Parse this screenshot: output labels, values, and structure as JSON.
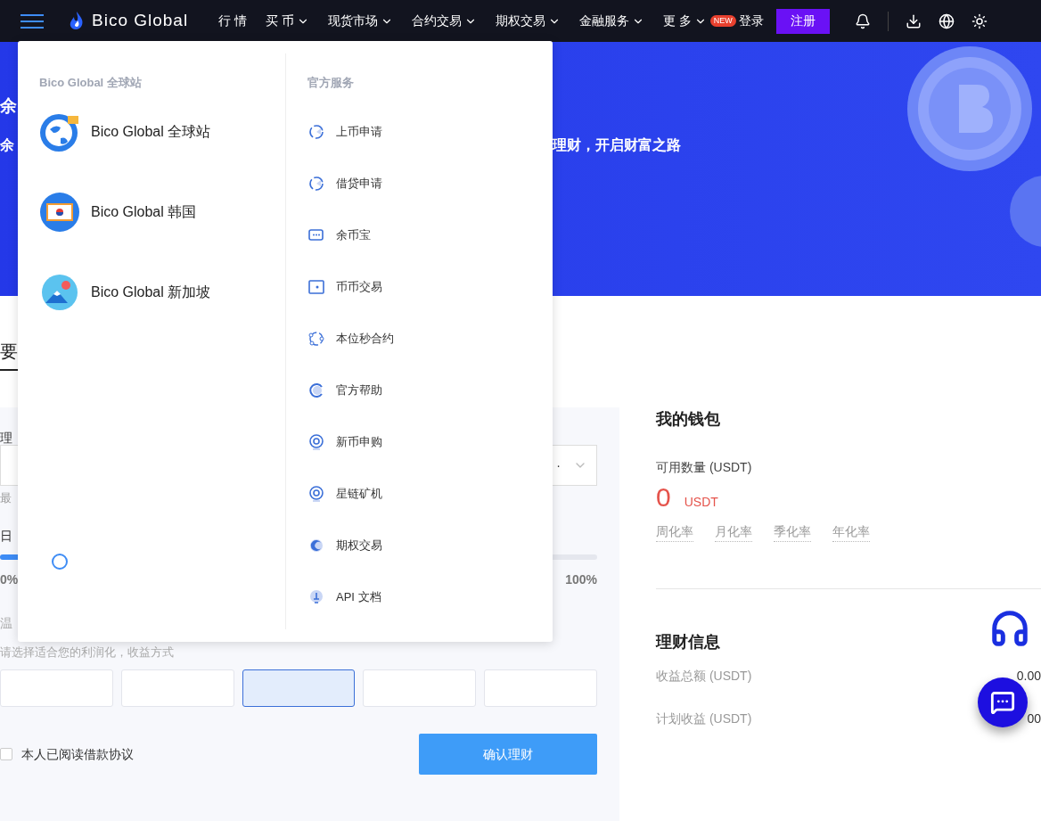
{
  "header": {
    "logo": "Bico Global",
    "nav": [
      {
        "label": "行 情",
        "dropdown": false
      },
      {
        "label": "买 币",
        "dropdown": true
      },
      {
        "label": "现货市场",
        "dropdown": true
      },
      {
        "label": "合约交易",
        "dropdown": true
      },
      {
        "label": "期权交易",
        "dropdown": true
      },
      {
        "label": "金融服务",
        "dropdown": true
      },
      {
        "label": "更 多",
        "dropdown": true
      }
    ],
    "new_badge": "NEW",
    "login": "登录",
    "register": "注册"
  },
  "hero": {
    "title_fragment": "余",
    "subtitle_fragments": [
      "余",
      "理财，开启财富之路"
    ]
  },
  "tabs": [
    {
      "label": "要",
      "selected": true
    }
  ],
  "form": {
    "field_label_fragment": "理",
    "select_mark": "·",
    "min_fragment": "最",
    "rate_fragment": "日",
    "slider": {
      "level": 0.1
    },
    "slider_min": "0%",
    "slider_max": "100%",
    "tip_fragment": "温",
    "hint": "请选择适合您的利润化，收益方式",
    "options": [
      {
        "selected": false
      },
      {
        "selected": false
      },
      {
        "selected": true
      },
      {
        "selected": false
      },
      {
        "selected": false
      }
    ],
    "agree": {
      "label": "本人已阅读借款协议",
      "checked": false
    },
    "submit": "确认理财"
  },
  "wallet": {
    "title": "我的钱包",
    "available_label": "可用数量 (USDT)",
    "amount": "0",
    "unit": "USDT",
    "rates": [
      "周化率",
      "月化率",
      "季化率",
      "年化率"
    ]
  },
  "info": {
    "title": "理财信息",
    "rows": [
      {
        "label": "收益总额 (USDT)",
        "value": "0.00"
      },
      {
        "label": "计划收益 (USDT)",
        "value": "00"
      }
    ]
  },
  "menu": {
    "sites_heading": "Bico Global 全球站",
    "sites": [
      "Bico Global 全球站",
      "Bico Global 韩国",
      "Bico Global 新加坡"
    ],
    "services_heading": "官方服务",
    "services": [
      "上币申请",
      "借贷申请",
      "余币宝",
      "币币交易",
      "本位秒合约",
      "官方帮助",
      "新币申购",
      "星链矿机",
      "期权交易",
      "API 文档"
    ]
  }
}
